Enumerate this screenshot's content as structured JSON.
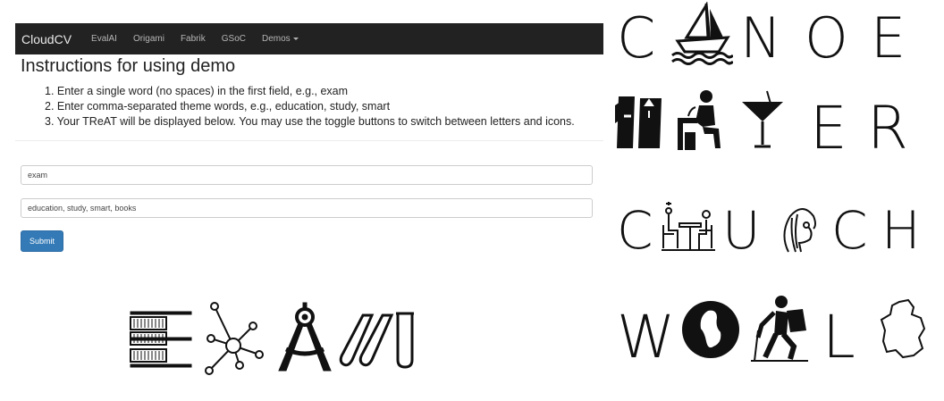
{
  "navbar": {
    "brand": "CloudCV",
    "items": [
      "EvalAI",
      "Origami",
      "Fabrik",
      "GSoC",
      "Demos"
    ]
  },
  "instructions": {
    "title": "Instructions for using demo",
    "steps": [
      "1. Enter a single word (no spaces) in the first field, e.g., exam",
      "2. Enter comma-separated theme words, e.g., education, study, smart",
      "3. Your TReAT will be displayed below. You may use the toggle buttons to switch between letters and icons."
    ]
  },
  "form": {
    "word_value": "exam",
    "themes_value": "education, study, smart, books",
    "submit_label": "Submit"
  },
  "treat_result": {
    "icons": [
      "books-stack-icon",
      "molecule-network-icon",
      "compass-drafting-icon",
      "test-tubes-icon"
    ]
  },
  "examples": [
    {
      "word": "CANOE",
      "letters": [
        "C",
        "N",
        "O",
        "E"
      ],
      "icons": [
        "sailboat-icon"
      ]
    },
    {
      "word": "WATER",
      "letters": [
        "E",
        "R"
      ],
      "icons": [
        "water-glasses-icon",
        "drinking-fountain-icon",
        "martini-glass-icon"
      ]
    },
    {
      "word": "CHURCH",
      "letters": [
        "C",
        "U",
        "C",
        "H"
      ],
      "icons": [
        "people-at-table-icon",
        "woman-profile-icon"
      ]
    },
    {
      "word": "WORLD",
      "letters": [
        "W",
        "L"
      ],
      "icons": [
        "globe-map-icon",
        "hiker-icon",
        "country-map-icon"
      ]
    }
  ]
}
